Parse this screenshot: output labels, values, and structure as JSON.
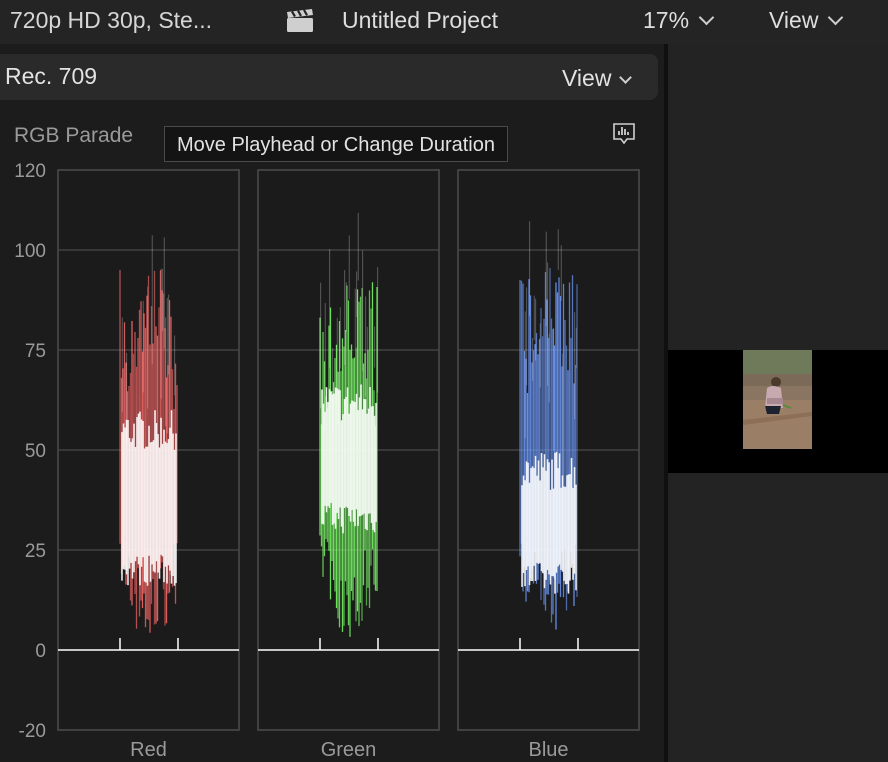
{
  "toolbar": {
    "format_label": "720p HD 30p, Ste...",
    "clapper_icon": "clapperboard-icon",
    "project_name": "Untitled Project",
    "zoom_label": "17%",
    "view_label": "View"
  },
  "scope_panel": {
    "standard_label": "Rec. 709",
    "view_label": "View",
    "scope_type": "RGB Parade",
    "tooltip": "Move Playhead or Change Duration",
    "settings_icon": "waveform-settings-icon"
  },
  "colors": {
    "red_channel": "#ff6a6a",
    "green_channel": "#7dff6a",
    "blue_channel": "#6f9cff",
    "grid": "#4a4a4a",
    "background": "#1e1e1e"
  },
  "chart_data": {
    "type": "area",
    "title": "",
    "xlabel": "",
    "ylabel": "",
    "ylim": [
      -20,
      120
    ],
    "yticks": [
      120,
      100,
      75,
      50,
      25,
      0,
      -20
    ],
    "grid": true,
    "categories": [
      "Red",
      "Green",
      "Blue"
    ],
    "series": [
      {
        "name": "Red",
        "color": "#ff6a6a",
        "max": 95,
        "core_min": 20,
        "core_max": 55,
        "min": 0
      },
      {
        "name": "Green",
        "color": "#7dff6a",
        "max": 92,
        "core_min": 33,
        "core_max": 62,
        "min": 2
      },
      {
        "name": "Blue",
        "color": "#6f9cff",
        "max": 96,
        "core_min": 18,
        "core_max": 45,
        "min": 2
      }
    ]
  }
}
